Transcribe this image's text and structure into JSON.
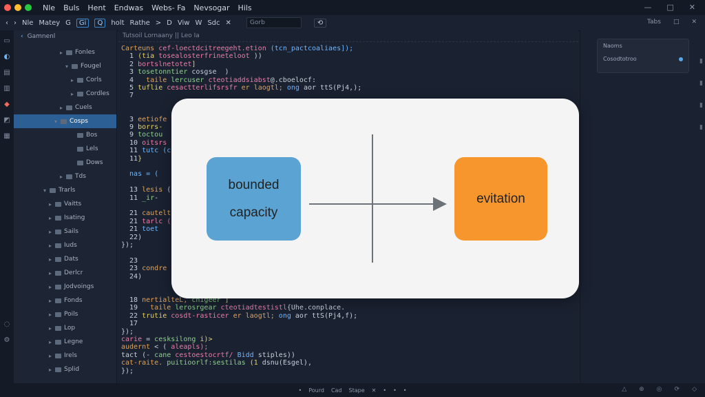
{
  "titlebar": {
    "menu": [
      "Nle",
      "Buls",
      "Hent",
      "Endwas",
      "Webs- Fa",
      "Nevsogar",
      "Hils"
    ],
    "controls": [
      "—",
      "□",
      "✕"
    ]
  },
  "toolbar": {
    "back": "‹",
    "forward": "›",
    "items": [
      "Nle",
      "Matey",
      "G",
      "Gi",
      "Q",
      "holt",
      "Rathe",
      ">",
      "D",
      "Viw",
      "W",
      "Sdc",
      "✕"
    ],
    "search_placeholder": "Gorb",
    "right_items": [
      "Tabs",
      "□",
      "✕"
    ]
  },
  "sidebar": {
    "header": "Gamnenl",
    "items": [
      {
        "label": "Fonles",
        "depth": 3,
        "arrow": "▸"
      },
      {
        "label": "Fougel",
        "depth": 4,
        "arrow": "▾"
      },
      {
        "label": "Corls",
        "depth": 5,
        "arrow": "▸"
      },
      {
        "label": "Cordles",
        "depth": 5,
        "arrow": "▸"
      },
      {
        "label": "Cuels",
        "depth": 3,
        "arrow": "▸"
      },
      {
        "label": "Cosps",
        "depth": 2,
        "arrow": "▾"
      },
      {
        "label": "Bos",
        "depth": 5,
        "arrow": ""
      },
      {
        "label": "Lels",
        "depth": 5,
        "arrow": ""
      },
      {
        "label": "Dows",
        "depth": 5,
        "arrow": ""
      },
      {
        "label": "Tds",
        "depth": 3,
        "arrow": "▸"
      },
      {
        "label": "Trarls",
        "depth": 0,
        "arrow": "▾"
      },
      {
        "label": "Vaitts",
        "depth": 1,
        "arrow": "▸"
      },
      {
        "label": "Isating",
        "depth": 1,
        "arrow": "▸"
      },
      {
        "label": "Sails",
        "depth": 1,
        "arrow": "▸"
      },
      {
        "label": "Iuds",
        "depth": 1,
        "arrow": "▸"
      },
      {
        "label": "Dats",
        "depth": 1,
        "arrow": "▸"
      },
      {
        "label": "Derlcr",
        "depth": 1,
        "arrow": "▸"
      },
      {
        "label": "Jodvoings",
        "depth": 1,
        "arrow": "▸"
      },
      {
        "label": "Fonds",
        "depth": 1,
        "arrow": "▸"
      },
      {
        "label": "Poils",
        "depth": 1,
        "arrow": "▸"
      },
      {
        "label": "Lop",
        "depth": 1,
        "arrow": "▸"
      },
      {
        "label": "Legne",
        "depth": 1,
        "arrow": "▸"
      },
      {
        "label": "Irels",
        "depth": 1,
        "arrow": "▸"
      },
      {
        "label": "Splid",
        "depth": 1,
        "arrow": "▸"
      }
    ]
  },
  "editor": {
    "tab": "Tutsoil Lornaany || Leo Ia",
    "lines": [
      {
        "seg": [
          [
            "Carteuns",
            "k"
          ],
          [
            " cef-loectdcitreegeht.etion",
            "s"
          ],
          [
            " (tcn_pactcoaliaes]);",
            "b"
          ]
        ]
      },
      {
        "seg": [
          [
            "  1 ",
            ""
          ],
          [
            "(tia",
            "y"
          ],
          [
            " tosealosterfrineteloot",
            "s"
          ],
          [
            " ))",
            ""
          ]
        ]
      },
      {
        "seg": [
          [
            "  2 ",
            ""
          ],
          [
            "bortslnetotet",
            "s"
          ],
          [
            "]",
            "y"
          ]
        ]
      },
      {
        "seg": [
          [
            "  3 ",
            ""
          ],
          [
            "tosetonntier",
            "g"
          ],
          [
            " cosgse  )",
            ""
          ]
        ]
      },
      {
        "seg": [
          [
            "  4   ",
            ""
          ],
          [
            "taile",
            "k"
          ],
          [
            " lercuser",
            "g"
          ],
          [
            " cteotiaddsiabst",
            "s"
          ],
          [
            "@.cboelocf:",
            ""
          ]
        ]
      },
      {
        "seg": [
          [
            "  5 ",
            ""
          ],
          [
            "tuflie",
            "y"
          ],
          [
            " cesactterlifsrsfr",
            "s"
          ],
          [
            " er laogtl;",
            "k"
          ],
          [
            " ong",
            "b"
          ],
          [
            " aor ttS(Pj4,);",
            ""
          ]
        ]
      },
      {
        "seg": [
          [
            "  7 ",
            ""
          ]
        ]
      },
      {
        "seg": [
          [
            "",
            ""
          ]
        ]
      },
      {
        "seg": [
          [
            "",
            ""
          ]
        ]
      },
      {
        "seg": [
          [
            "  3 ",
            ""
          ],
          [
            "eetiofe",
            "k"
          ]
        ]
      },
      {
        "seg": [
          [
            "  9 ",
            ""
          ],
          [
            "borrs-",
            "y"
          ]
        ]
      },
      {
        "seg": [
          [
            "  9 ",
            ""
          ],
          [
            "toctou",
            "g"
          ]
        ]
      },
      {
        "seg": [
          [
            "  10 ",
            ""
          ],
          [
            "oitsrs",
            "s"
          ]
        ]
      },
      {
        "seg": [
          [
            "  11 ",
            ""
          ],
          [
            "tutc (c",
            "b"
          ]
        ]
      },
      {
        "seg": [
          [
            "  11",
            ""
          ],
          [
            "}",
            "y"
          ]
        ]
      },
      {
        "seg": [
          [
            "",
            ""
          ]
        ]
      },
      {
        "seg": [
          [
            "  nas = (",
            "b"
          ]
        ]
      },
      {
        "seg": [
          [
            "",
            ""
          ]
        ]
      },
      {
        "seg": [
          [
            "  13 ",
            ""
          ],
          [
            "lesis",
            "k"
          ],
          [
            " (",
            ""
          ]
        ]
      },
      {
        "seg": [
          [
            "  11 ",
            ""
          ],
          [
            "_ir",
            "g"
          ],
          [
            "-",
            ""
          ]
        ]
      },
      {
        "seg": [
          [
            "",
            ""
          ]
        ]
      },
      {
        "seg": [
          [
            "  21 ",
            ""
          ],
          [
            "cautelt",
            "k"
          ]
        ]
      },
      {
        "seg": [
          [
            "  21 ",
            ""
          ],
          [
            "tarlc (",
            "s"
          ]
        ]
      },
      {
        "seg": [
          [
            "  21 ",
            ""
          ],
          [
            "toet",
            "b"
          ]
        ]
      },
      {
        "seg": [
          [
            "  22)",
            ""
          ]
        ]
      },
      {
        "seg": [
          [
            "});",
            ""
          ]
        ]
      },
      {
        "seg": [
          [
            "",
            ""
          ]
        ]
      },
      {
        "seg": [
          [
            "  23",
            ""
          ]
        ]
      },
      {
        "seg": [
          [
            "  23 ",
            ""
          ],
          [
            "condre",
            "k"
          ]
        ]
      },
      {
        "seg": [
          [
            "  24)",
            ""
          ]
        ]
      },
      {
        "seg": [
          [
            "",
            ""
          ]
        ]
      },
      {
        "seg": [
          [
            "",
            ""
          ]
        ]
      },
      {
        "seg": [
          [
            "  18 ",
            ""
          ],
          [
            "nertialteL,",
            "k"
          ],
          [
            " cnigeer",
            "g"
          ],
          [
            " ]",
            "y"
          ]
        ]
      },
      {
        "seg": [
          [
            "  19   ",
            ""
          ],
          [
            "taile",
            "k"
          ],
          [
            " lerosrgear",
            "g"
          ],
          [
            " cteotiadtestistl",
            "s"
          ],
          [
            "{Uhe.conplace.",
            ""
          ]
        ]
      },
      {
        "seg": [
          [
            "  22 ",
            ""
          ],
          [
            "trutie",
            "y"
          ],
          [
            " cosdt-rasticer",
            "s"
          ],
          [
            " er laogtl;",
            "k"
          ],
          [
            " ong",
            "b"
          ],
          [
            " aor ttS(Pj4,f);",
            ""
          ]
        ]
      },
      {
        "seg": [
          [
            "  17",
            ""
          ]
        ]
      },
      {
        "seg": [
          [
            "});",
            ""
          ]
        ]
      },
      {
        "seg": [
          [
            "carie",
            "s"
          ],
          [
            " =",
            ""
          ],
          [
            " cesksilong",
            "g"
          ],
          [
            " i)>",
            "y"
          ]
        ]
      },
      {
        "seg": [
          [
            "audernt",
            "k"
          ],
          [
            " < (",
            ""
          ],
          [
            " aleapls);",
            "s"
          ]
        ]
      },
      {
        "seg": [
          [
            "tact (-",
            ""
          ],
          [
            " cane",
            "g"
          ],
          [
            " cestoestocrtf/",
            "s"
          ],
          [
            " Bidd",
            "b"
          ],
          [
            " stiples))",
            ""
          ]
        ]
      },
      {
        "seg": [
          [
            "cat-raite.",
            "k"
          ],
          [
            " puitioorlf:sestilas",
            "g"
          ],
          [
            " (1",
            "y"
          ],
          [
            " dsnu(Esgel),",
            ""
          ]
        ]
      },
      {
        "seg": [
          [
            "});",
            ""
          ]
        ]
      }
    ]
  },
  "diagram": {
    "left_node": [
      "bounded",
      "capacity"
    ],
    "right_node": "evitation",
    "colors": {
      "left": "#5aa3d2",
      "right": "#f8962e",
      "line": "#6d7178",
      "panel": "#f4f4f4"
    }
  },
  "rightpanel": {
    "title": "Naoms",
    "row_label": "Cosodtotroo"
  },
  "statusbar": {
    "items": [
      "•",
      "Pourd",
      "Cad",
      "Stape",
      "✕",
      "•",
      "•",
      "•"
    ],
    "right_icons": [
      "△",
      "⊕",
      "◎",
      "⟳",
      "◇"
    ]
  }
}
